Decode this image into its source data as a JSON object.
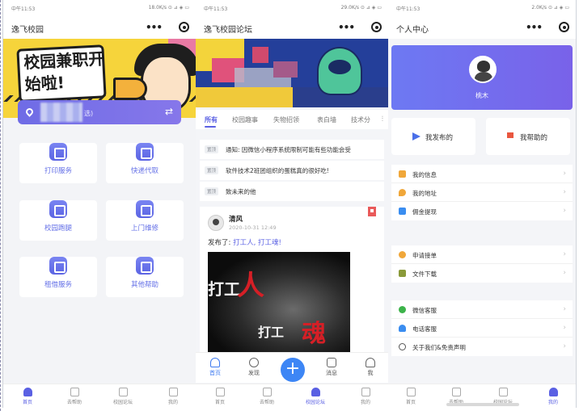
{
  "phone1": {
    "status": {
      "time": "中午11:53",
      "right": "18.0K/s ⊙ ⊿ ◈ ▭"
    },
    "nav_title": "逸飞校园",
    "banner_title": "校园兼职开始啦!",
    "location_suffix": "选)",
    "tiles": [
      {
        "label": "打印服务",
        "icon": "printer-icon"
      },
      {
        "label": "快递代取",
        "icon": "courier-icon"
      },
      {
        "label": "校园跑腿",
        "icon": "errand-icon"
      },
      {
        "label": "上门维修",
        "icon": "repair-icon"
      },
      {
        "label": "租借服务",
        "icon": "rent-icon"
      },
      {
        "label": "其他帮助",
        "icon": "more-icon"
      }
    ],
    "tabbar": [
      {
        "label": "首页",
        "icon": "home-icon"
      },
      {
        "label": "去帮助",
        "icon": "help-icon"
      },
      {
        "label": "校园论坛",
        "icon": "forum-icon"
      },
      {
        "label": "我的",
        "icon": "user-icon"
      }
    ]
  },
  "phone2": {
    "status": {
      "time": "中午11:53",
      "right": "29.0K/s ⊙ ⊿ ◈ ▭"
    },
    "nav_title": "逸飞校园论坛",
    "tabs": [
      "所有",
      "校园趣事",
      "失物招领",
      "表白墙",
      "技术分"
    ],
    "notices": [
      {
        "tag": "置顶",
        "text": "通知: 因微信小程序系统限制可能有些功能会受"
      },
      {
        "tag": "置顶",
        "text": "软件技术2班团组织的蛋糕真的很好吃!"
      },
      {
        "tag": "置顶",
        "text": "致未来的他"
      }
    ],
    "post": {
      "author": "清风",
      "time": "2020-10-31 12:49",
      "content_prefix": "发布了: ",
      "content_highlight": "打工人, 打工魂!"
    },
    "tabbar": [
      {
        "label": "首页",
        "icon": "home-icon"
      },
      {
        "label": "发现",
        "icon": "discover-icon"
      },
      {
        "label": "消息",
        "icon": "message-icon"
      },
      {
        "label": "我",
        "icon": "me-icon"
      }
    ],
    "fab_label": "+",
    "bottom_tabbar": [
      {
        "label": "首页"
      },
      {
        "label": "去帮助"
      },
      {
        "label": "校园论坛"
      },
      {
        "label": "我的"
      }
    ]
  },
  "phone3": {
    "status": {
      "time": "中午11:53",
      "right": "2.0K/s ⊙ ⊿ ◈ ▭"
    },
    "nav_title": "个人中心",
    "user_name": "桃木",
    "quick_actions": [
      {
        "label": "我发布的",
        "icon": "send-icon"
      },
      {
        "label": "我帮助的",
        "icon": "flag-icon"
      }
    ],
    "menu_group1": [
      {
        "label": "我的信息",
        "color": "#f0a73a",
        "icon": "info-icon"
      },
      {
        "label": "我的地址",
        "color": "#f0a73a",
        "icon": "location-icon"
      },
      {
        "label": "佣金提现",
        "color": "#3a8df0",
        "icon": "wallet-icon"
      }
    ],
    "menu_group2": [
      {
        "label": "申请接单",
        "color": "#f0a73a",
        "icon": "apply-icon"
      },
      {
        "label": "文件下载",
        "color": "#8a9a3a",
        "icon": "download-icon"
      }
    ],
    "menu_group3": [
      {
        "label": "微信客服",
        "color": "#3cb34a",
        "icon": "wechat-icon"
      },
      {
        "label": "电话客服",
        "color": "#3a8df0",
        "icon": "phone-icon"
      },
      {
        "label": "关于我们&免责声明",
        "color": "#555555",
        "icon": "about-icon"
      }
    ],
    "tabbar": [
      {
        "label": "首页"
      },
      {
        "label": "去帮助"
      },
      {
        "label": "校园论坛"
      },
      {
        "label": "我的"
      }
    ]
  },
  "colors": {
    "accent": "#5a60e3",
    "blue": "#3d86f5",
    "banner_yellow": "#f6d43b"
  }
}
